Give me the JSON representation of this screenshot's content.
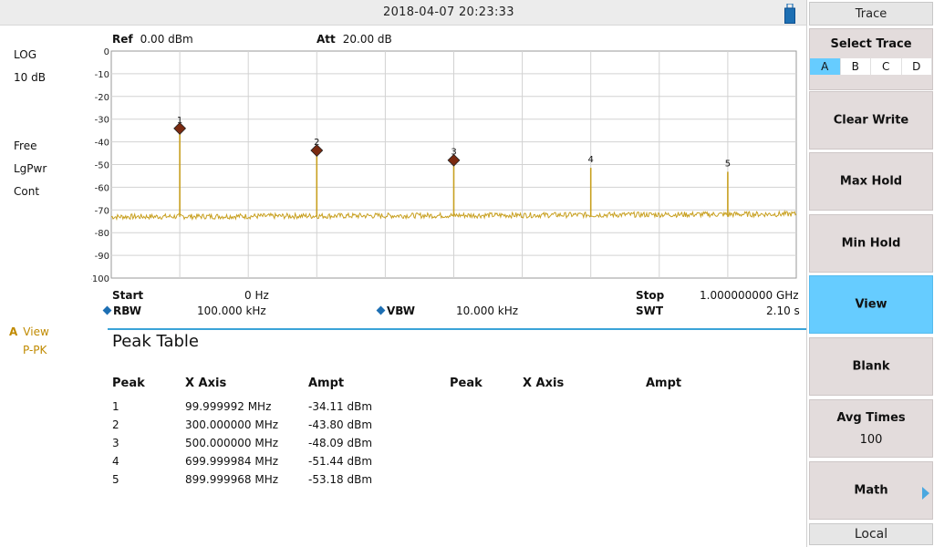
{
  "status_bar": {
    "datetime": "2018-04-07   20:23:33"
  },
  "left_panel": {
    "scale_mode": "LOG",
    "scale_div": "10 dB",
    "sweep_mode": "Free",
    "avg_type": "LgPwr",
    "sweep_cont": "Cont",
    "trace_letter": "A",
    "trace_state": "View",
    "detector": "P-PK"
  },
  "header": {
    "ref_label": "Ref",
    "ref_value": "0.00 dBm",
    "att_label": "Att",
    "att_value": "20.00 dB"
  },
  "footer": {
    "start_label": "Start",
    "start_value": "0 Hz",
    "stop_label": "Stop",
    "stop_value": "1.000000000 GHz",
    "rbw_label": "RBW",
    "rbw_value": "100.000 kHz",
    "vbw_label": "VBW",
    "vbw_value": "10.000 kHz",
    "swt_label": "SWT",
    "swt_value": "2.10 s"
  },
  "peak_table": {
    "title": "Peak Table",
    "headers": [
      "Peak",
      "X Axis",
      "Ampt",
      "Peak",
      "X Axis",
      "Ampt"
    ],
    "rows": [
      [
        "1",
        "99.999992 MHz",
        "-34.11 dBm"
      ],
      [
        "2",
        "300.000000 MHz",
        "-43.80 dBm"
      ],
      [
        "3",
        "500.000000 MHz",
        "-48.09 dBm"
      ],
      [
        "4",
        "699.999984 MHz",
        "-51.44 dBm"
      ],
      [
        "5",
        "899.999968 MHz",
        "-53.18 dBm"
      ]
    ]
  },
  "menu": {
    "title": "Trace",
    "select_trace": "Select Trace",
    "traces": [
      "A",
      "B",
      "C",
      "D"
    ],
    "selected_trace": "A",
    "items": [
      "Clear Write",
      "Max Hold",
      "Min Hold",
      "View",
      "Blank"
    ],
    "active_item": "View",
    "avg_times_label": "Avg Times",
    "avg_times_value": "100",
    "math_label": "Math",
    "local": "Local"
  },
  "chart_data": {
    "type": "line",
    "title": "",
    "xlabel": "",
    "ylabel": "",
    "x_unit": "MHz",
    "y_unit": "dBm",
    "xlim": [
      0,
      1000
    ],
    "ylim": [
      -100,
      0
    ],
    "y_ticks": [
      0,
      -10,
      -20,
      -30,
      -40,
      -50,
      -60,
      -70,
      -80,
      -90,
      -100
    ],
    "grid": true,
    "trace_color": "#c8a020",
    "marker_fill": "#7a2a10",
    "noise_floor": -73,
    "peaks": [
      {
        "label": "1",
        "x": 100,
        "y": -34.11,
        "marker": true
      },
      {
        "label": "2",
        "x": 300,
        "y": -43.8,
        "marker": true
      },
      {
        "label": "3",
        "x": 500,
        "y": -48.09,
        "marker": true
      },
      {
        "label": "4",
        "x": 700,
        "y": -51.44,
        "marker": false
      },
      {
        "label": "5",
        "x": 900,
        "y": -53.18,
        "marker": false
      }
    ]
  }
}
